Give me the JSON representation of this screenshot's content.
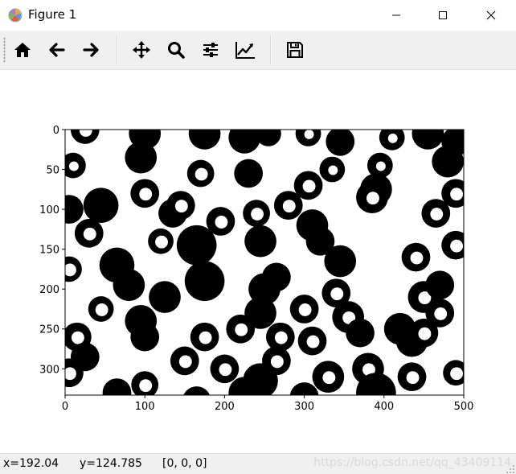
{
  "window": {
    "title": "Figure 1",
    "minimize_icon": "minimize-icon",
    "maximize_icon": "maximize-icon",
    "close_icon": "close-icon"
  },
  "toolbar": {
    "items": [
      {
        "name": "home-button",
        "icon": "home-icon"
      },
      {
        "name": "back-button",
        "icon": "arrow-left-icon"
      },
      {
        "name": "forward-button",
        "icon": "arrow-right-icon"
      },
      {
        "name": "pan-button",
        "icon": "move-icon"
      },
      {
        "name": "zoom-button",
        "icon": "magnifier-icon"
      },
      {
        "name": "configure-subplots-button",
        "icon": "sliders-icon"
      },
      {
        "name": "edit-axis-button",
        "icon": "chart-line-icon"
      },
      {
        "name": "save-button",
        "icon": "floppy-disk-icon"
      }
    ]
  },
  "figure": {
    "x_ticks": [
      "0",
      "100",
      "200",
      "300",
      "400",
      "500"
    ],
    "y_ticks": [
      "0",
      "50",
      "100",
      "150",
      "200",
      "250",
      "300"
    ],
    "image_description_colors": {
      "foreground": "#000000",
      "background": "#ffffff"
    }
  },
  "status": {
    "x_readout": "x=192.04",
    "y_readout": "y=124.785",
    "pixel_value": "[0, 0, 0]",
    "watermark": "https://blog.csdn.net/qq_43409114"
  }
}
